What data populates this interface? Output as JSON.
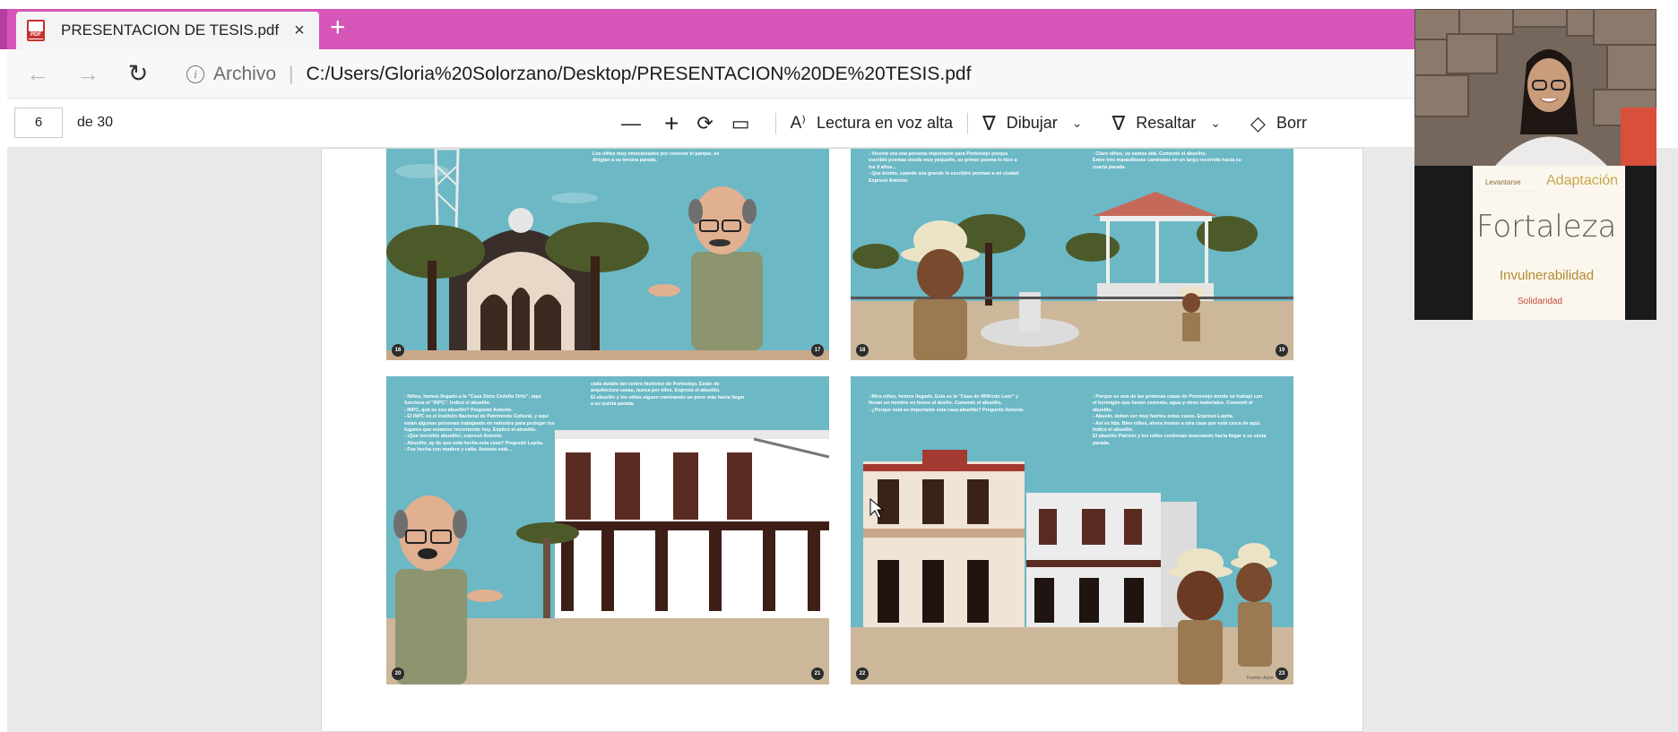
{
  "colors": {
    "tab_strip": "#d556b8",
    "illustration_sky": "#6cb8c5",
    "building_brown": "#5a2b22"
  },
  "tab": {
    "title": "PRESENTACION DE TESIS.pdf",
    "file_icon": "pdf-file-icon",
    "close_glyph": "×",
    "new_tab_glyph": "+"
  },
  "address": {
    "back_glyph": "←",
    "forward_glyph": "→",
    "reload_glyph": "↻",
    "scheme_label": "Archivo",
    "separator": "|",
    "url": "C:/Users/Gloria%20Solorzano/Desktop/PRESENTACION%20DE%20TESIS.pdf",
    "zoom_glyph": "⊖"
  },
  "pdf_toolbar": {
    "page_value": "6",
    "page_total_label": "de 30",
    "zoom_out_glyph": "—",
    "zoom_in_glyph": "+",
    "rotate_glyph": "⟳",
    "fit_glyph": "▭",
    "read_aloud_label": "Lectura en voz alta",
    "read_aloud_glyph": "A⁾",
    "draw_label": "Dibujar",
    "draw_glyph": "∇",
    "highlight_label": "Resaltar",
    "highlight_glyph": "∇",
    "erase_label": "Borr",
    "erase_glyph": "◇",
    "chevron_glyph": "⌄"
  },
  "panels": [
    {
      "text": "Los niños muy emocionados por conocer el parque, se dirigían a su tercera parada.",
      "page_left": "16",
      "page_right": "17"
    },
    {
      "text_left": "- Vicente era una persona importante para Portoviejo porque escribió poemas desde muy pequeño, su primer poema lo hizo a los 9 años...\n- Que bonito, cuando sea grande lo escribiré poemas a mi ciudad. Expresó Antonio.",
      "text_right": "- Claro niños, ya vamos allá. Comentó el abuelito.\nEntre tres maravillosas caminatas en un largo recorrido hacia su cuarta parada.",
      "page_left": "18",
      "page_right": "19"
    },
    {
      "text_left": "- Niños, hemos llegado a la \"Casa Sixto Cedeño Ortíz\", aquí funciona el \"INPC\". Indicó el abuelito.\n- INPC, qué es eso abuelito? Preguntó Antonio.\n- El INPC es el Instituto Nacional de Patrimonio Cultural, y aquí están algunas personas trabajando en métodos para proteger los lugares que estamos recorriendo hoy. Explicó el abuelito.\n- ¡Que increíble abuelito!, expresó Antonio.\n- Abuelito, ay de que está hecha esta casa? Preguntó Lupita.\n- Fue hecha con madera y caña. Antonio está...",
      "text_right": "cada detalle del centro histórico de Portoviejo. Están de arquitectura casas, nunca por ellos. Expresó el abuelito.\nEl abuelito y los niños siguen caminando un poco más hacia llegar a su quinta parada.",
      "page_left": "20",
      "page_right": "21"
    },
    {
      "text_left": "- Mira niños, hemos llegado. Esta es la \"Casa de Wilfredo Loor\" y llevan un nombre en honor al dueño. Comentó el abuelito.\n- ¿Porque está es importante esta casa abuelito? Preguntó Antonio.",
      "text_right": "- Porque es una de las primeras casas de Portoviejo donde se trabajó con el hormigón que tienen cemento, agua y otros materiales. Comentó el abuelito.\n- Abuelo, deben ser muy fuertes estas casas. Expresó Lupita.\n- Así es hija. Bien niños, ahora iremos a otra casa que está cerca de aquí. Indicó el abuelito.\nEl abuelito Patricio y los niños continúan avanzando hacia llegar a su sexta parada.",
      "page_left": "22",
      "page_right": "23",
      "credit": "Fuente: Autor"
    }
  ],
  "webcam_slide": {
    "words": [
      "Fortaleza",
      "Adaptación",
      "Invulnerabilidad",
      "Solidaridad",
      "Levantarse"
    ]
  }
}
